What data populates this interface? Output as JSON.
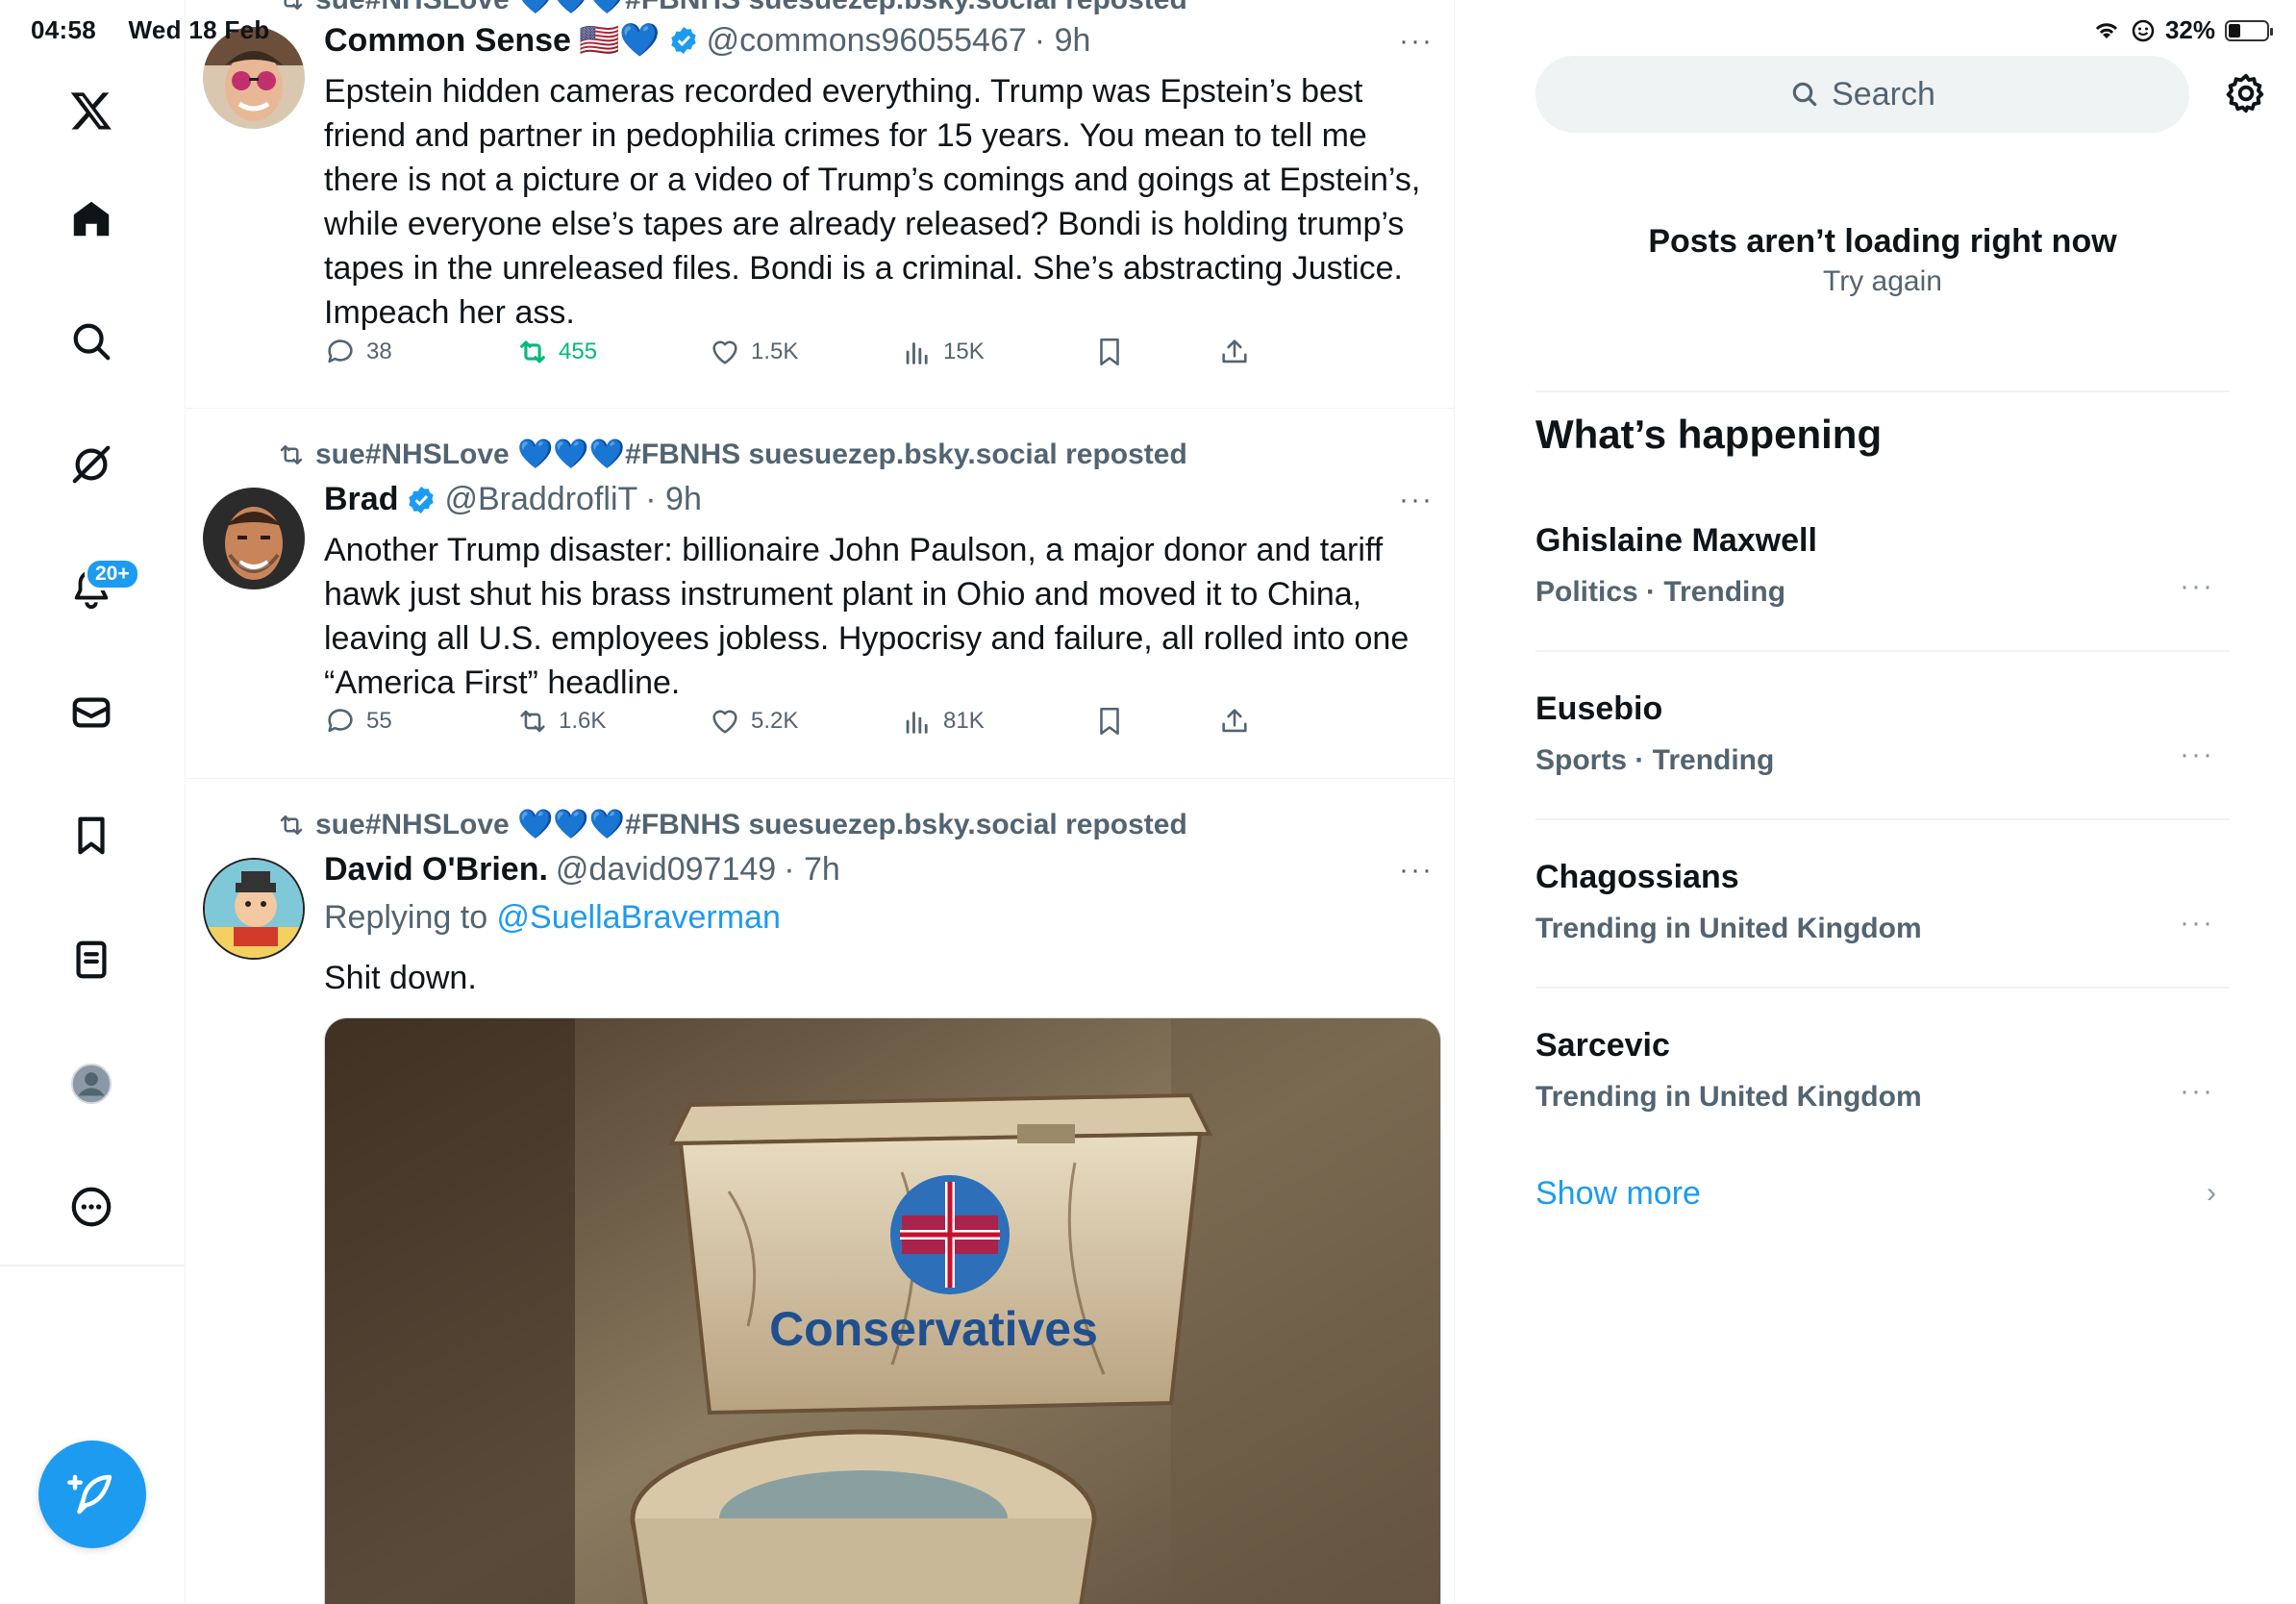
{
  "status": {
    "time": "04:58",
    "date": "Wed 18 Feb",
    "battery": "32%",
    "battery_level": 0.32
  },
  "nav": {
    "items": [
      "x-logo",
      "home",
      "explore",
      "grok",
      "notifications",
      "messages",
      "bookmarks",
      "lists",
      "profile",
      "more"
    ],
    "notifications_badge": "20+"
  },
  "feed": {
    "top_partial_repost": "sue#NHSLove 💙💙💙#FBNHS suesuezep.bsky.social reposted",
    "tweets": [
      {
        "name": "Common Sense",
        "flag": "🇺🇸💙",
        "handle": "@commons96055467",
        "time": "· 9h",
        "text": "Epstein hidden cameras recorded everything. Trump was Epstein’s best friend and partner in pedophilia crimes for 15 years. You mean to tell me there is not a picture or a video of Trump’s comings and goings at Epstein’s, while everyone else’s tapes are already released? Bondi is holding trump’s tapes in the unreleased files. Bondi is a criminal. She’s abstracting Justice. Impeach her ass.",
        "replies": "38",
        "reposts": "455",
        "likes": "1.5K",
        "views": "15K"
      },
      {
        "repost_by": "sue#NHSLove 💙💙💙#FBNHS suesuezep.bsky.social reposted",
        "name": "Brad",
        "handle": "@BraddrofliT",
        "time": "· 9h",
        "text": "Another Trump disaster: billionaire John Paulson, a major donor and tariff hawk just shut his brass instrument plant in Ohio and moved it to China, leaving all U.S. employees jobless. Hypocrisy and failure, all rolled into one “America First” headline.",
        "replies": "55",
        "reposts": "1.6K",
        "likes": "5.2K",
        "views": "81K"
      },
      {
        "repost_by": "sue#NHSLove 💙💙💙#FBNHS suesuezep.bsky.social reposted",
        "name": "David O'Brien.",
        "handle": "@david097149",
        "time": "· 7h",
        "reply_prefix": "Replying to ",
        "reply_to": "@SuellaBraverman",
        "text": "Shit down.",
        "image_text": "Conservatives"
      }
    ]
  },
  "sidebar": {
    "search_placeholder": "Search",
    "error_title": "Posts aren’t loading right now",
    "error_retry": "Try again",
    "whats_happening": "What’s happening",
    "trends": [
      {
        "name": "Ghislaine Maxwell",
        "meta": "Politics · Trending"
      },
      {
        "name": "Eusebio",
        "meta": "Sports · Trending"
      },
      {
        "name": "Chagossians",
        "meta": "Trending in United Kingdom"
      },
      {
        "name": "Sarcevic",
        "meta": "Trending in United Kingdom"
      }
    ],
    "show_more": "Show more"
  },
  "colors": {
    "accent": "#1d9bf0",
    "repost_green": "#00ba7c",
    "muted": "#536471"
  }
}
